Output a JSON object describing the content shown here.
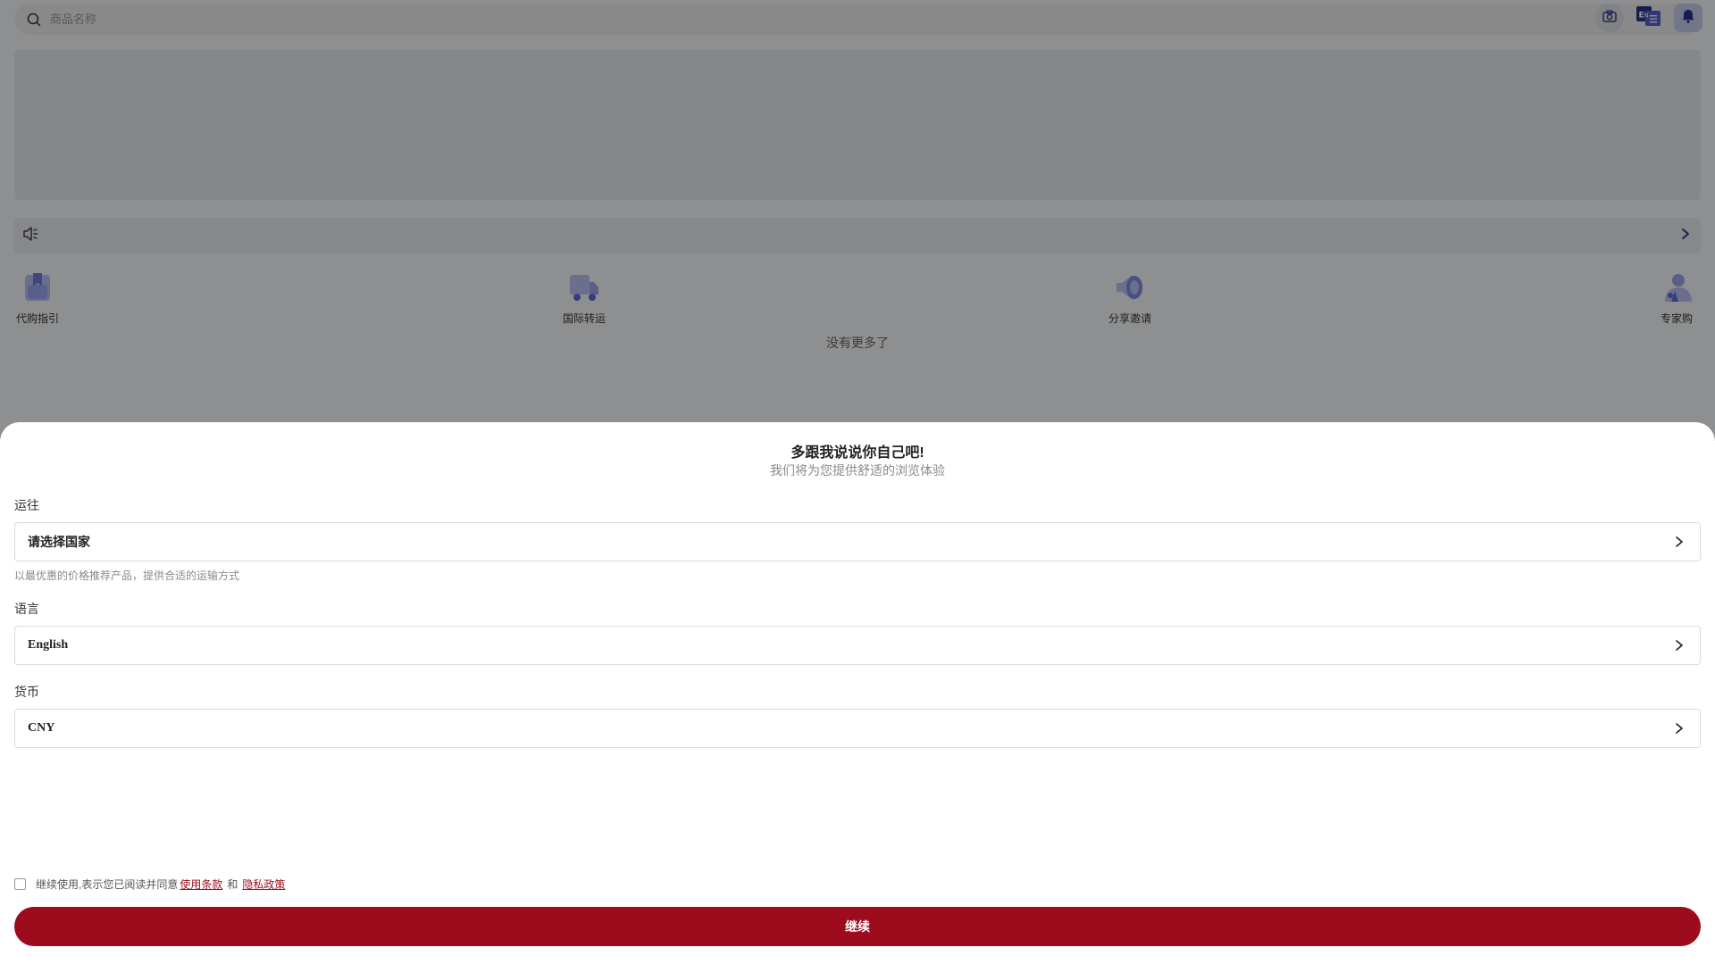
{
  "search": {
    "placeholder": "商品名称"
  },
  "features": [
    {
      "label": "代购指引",
      "icon": "bookmark-box-icon"
    },
    {
      "label": "国际转运",
      "icon": "truck-icon"
    },
    {
      "label": "分享邀请",
      "icon": "megaphone-icon"
    },
    {
      "label": "专家购",
      "icon": "expert-person-icon"
    }
  ],
  "no_more_text": "没有更多了",
  "sheet": {
    "title": "多跟我说说你自己吧!",
    "subtitle": "我们将为您提供舒适的浏览体验",
    "ship_to": {
      "label": "运往",
      "value": "请选择国家",
      "hint": "以最优惠的价格推荐产品，提供合适的运输方式"
    },
    "language": {
      "label": "语言",
      "value": "English"
    },
    "currency": {
      "label": "货币",
      "value": "CNY"
    },
    "agreement": {
      "prefix": "继续使用,表示您已阅读并同意",
      "terms": "使用条款",
      "and": "和",
      "privacy": "隐私政策"
    },
    "continue_label": "继续"
  },
  "colors": {
    "primary": "#9c0c1c",
    "icon_accent": "#7f8be0",
    "overlay": "rgba(0,0,0,0.42)"
  }
}
